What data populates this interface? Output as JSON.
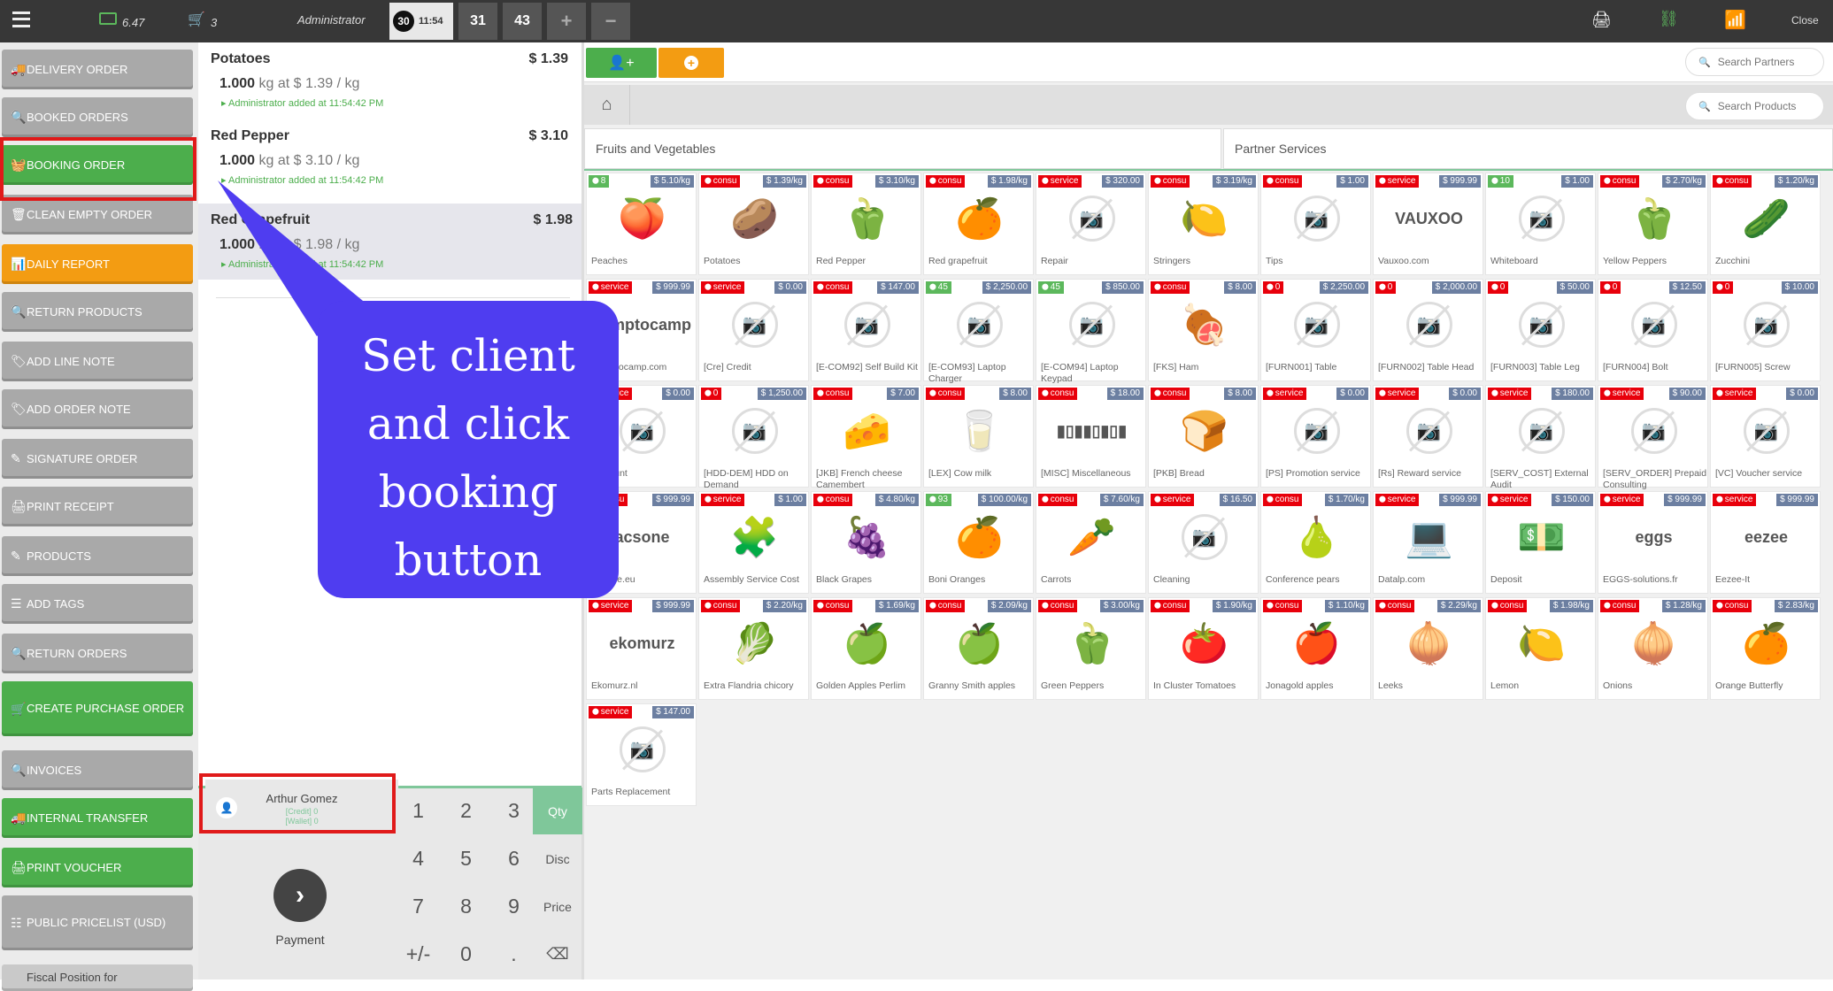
{
  "topbar": {
    "cash": "6.47",
    "cart_count": "3",
    "user": "Administrator",
    "active_order_num": "30",
    "active_order_time": "11:54",
    "tabs": [
      "31",
      "43"
    ],
    "plus": "+",
    "minus": "−",
    "close_label": "Close"
  },
  "left_controls": [
    {
      "label": "DELIVERY ORDER",
      "icon": "truck-icon",
      "glyph": "🚚"
    },
    {
      "label": "BOOKED ORDERS",
      "icon": "search-icon",
      "glyph": "🔍"
    },
    {
      "label": "BOOKING ORDER",
      "icon": "basket-icon",
      "glyph": "🧺"
    },
    {
      "label": "CLEAN EMPTY ORDER",
      "icon": "trash-icon",
      "glyph": "🗑"
    },
    {
      "label": "DAILY REPORT",
      "icon": "bar-chart-icon",
      "glyph": "📊"
    },
    {
      "label": "RETURN PRODUCTS",
      "icon": "search-icon",
      "glyph": "🔍"
    },
    {
      "label": "ADD LINE NOTE",
      "icon": "tag-icon",
      "glyph": "🏷"
    },
    {
      "label": "ADD ORDER NOTE",
      "icon": "tag-icon",
      "glyph": "🏷"
    },
    {
      "label": "SIGNATURE ORDER",
      "icon": "edit-icon",
      "glyph": "✎"
    },
    {
      "label": "PRINT RECEIPT",
      "icon": "print-icon",
      "glyph": "🖨"
    },
    {
      "label": "PRODUCTS",
      "icon": "edit-icon",
      "glyph": "✎"
    },
    {
      "label": "ADD TAGS",
      "icon": "sliders-icon",
      "glyph": "☰"
    },
    {
      "label": "RETURN ORDERS",
      "icon": "search-icon",
      "glyph": "🔍"
    },
    {
      "label": "CREATE PURCHASE ORDER",
      "icon": "cart-icon",
      "glyph": "🛒"
    },
    {
      "label": "INVOICES",
      "icon": "search-icon",
      "glyph": "🔍"
    },
    {
      "label": "INTERNAL TRANSFER",
      "icon": "truck-icon",
      "glyph": "🚚"
    },
    {
      "label": "PRINT VOUCHER",
      "icon": "print-icon",
      "glyph": "🖨"
    },
    {
      "label": "PUBLIC PRICELIST (USD)",
      "icon": "list-icon",
      "glyph": "☷"
    },
    {
      "label": "Fiscal Position for",
      "icon": "",
      "glyph": ""
    }
  ],
  "order_lines": [
    {
      "name": "Potatoes",
      "price": "$ 1.39",
      "qty": "1.000",
      "qty_text": "kg at $ 1.39 / kg",
      "note": "Administrator added at 11:54:42 PM"
    },
    {
      "name": "Red Pepper",
      "price": "$ 3.10",
      "qty": "1.000",
      "qty_text": "kg at $ 3.10 / kg",
      "note": "Administrator added at 11:54:42 PM"
    },
    {
      "name": "Red Grapefruit",
      "price": "$ 1.98",
      "qty": "1.000",
      "qty_text": "kg at $ 1.98 / kg",
      "note": "Administrator added at 11:54:42 PM"
    }
  ],
  "client": {
    "name": "Arthur Gomez",
    "credit": "[Credit] 0",
    "wallet": "[Wallet] 0"
  },
  "payment_label": "Payment",
  "numpad": {
    "keys": [
      "1",
      "2",
      "3",
      "4",
      "5",
      "6",
      "7",
      "8",
      "9",
      "+/-",
      "0",
      "."
    ],
    "modes": [
      "Qty",
      "Disc",
      "Price"
    ]
  },
  "callout": {
    "text": "Set client and click booking button"
  },
  "search": {
    "partners_placeholder": "Search Partners",
    "products_placeholder": "Search Products"
  },
  "categories": [
    "Fruits and Vegetables",
    "Partner Services"
  ],
  "products": [
    {
      "name": "Peaches",
      "tag": "8",
      "tag_type": "green",
      "price": "$ 5.10/kg",
      "img": "🍑"
    },
    {
      "name": "Potatoes",
      "tag": "consu",
      "tag_type": "red",
      "price": "$ 1.39/kg",
      "img": "🥔"
    },
    {
      "name": "Red Pepper",
      "tag": "consu",
      "tag_type": "red",
      "price": "$ 3.10/kg",
      "img": "🫑"
    },
    {
      "name": "Red grapefruit",
      "tag": "consu",
      "tag_type": "red",
      "price": "$ 1.98/kg",
      "img": "🍊"
    },
    {
      "name": "Repair",
      "tag": "service",
      "tag_type": "red",
      "price": "$ 320.00",
      "img": ""
    },
    {
      "name": "Stringers",
      "tag": "consu",
      "tag_type": "red",
      "price": "$ 3.19/kg",
      "img": "🍋"
    },
    {
      "name": "Tips",
      "tag": "consu",
      "tag_type": "red",
      "price": "$ 1.00",
      "img": ""
    },
    {
      "name": "Vauxoo.com",
      "tag": "service",
      "tag_type": "red",
      "price": "$ 999.99",
      "img": "VAUXOO"
    },
    {
      "name": "Whiteboard",
      "tag": "10",
      "tag_type": "green",
      "price": "$ 1.00",
      "img": ""
    },
    {
      "name": "Yellow Peppers",
      "tag": "consu",
      "tag_type": "red",
      "price": "$ 2.70/kg",
      "img": "🫑"
    },
    {
      "name": "Zucchini",
      "tag": "consu",
      "tag_type": "red",
      "price": "$ 1.20/kg",
      "img": "🥒"
    },
    {
      "name": "Camptocamp.com",
      "tag": "service",
      "tag_type": "red",
      "price": "$ 999.99",
      "img": "camptocamp"
    },
    {
      "name": "[Cre] Credit",
      "tag": "service",
      "tag_type": "red",
      "price": "$ 0.00",
      "img": ""
    },
    {
      "name": "[E-COM92] Self Build Kit",
      "tag": "consu",
      "tag_type": "red",
      "price": "$ 147.00",
      "img": ""
    },
    {
      "name": "[E-COM93] Laptop Charger",
      "tag": "45",
      "tag_type": "green",
      "price": "$ 2,250.00",
      "img": ""
    },
    {
      "name": "[E-COM94] Laptop Keypad",
      "tag": "45",
      "tag_type": "green",
      "price": "$ 850.00",
      "img": ""
    },
    {
      "name": "[FKS] Ham",
      "tag": "consu",
      "tag_type": "red",
      "price": "$ 8.00",
      "img": "🍖"
    },
    {
      "name": "[FURN001] Table",
      "tag": "0",
      "tag_type": "red",
      "price": "$ 2,250.00",
      "img": ""
    },
    {
      "name": "[FURN002] Table Head",
      "tag": "0",
      "tag_type": "red",
      "price": "$ 2,000.00",
      "img": ""
    },
    {
      "name": "[FURN003] Table Leg",
      "tag": "0",
      "tag_type": "red",
      "price": "$ 50.00",
      "img": ""
    },
    {
      "name": "[FURN004] Bolt",
      "tag": "0",
      "tag_type": "red",
      "price": "$ 12.50",
      "img": ""
    },
    {
      "name": "[FURN005] Screw",
      "tag": "0",
      "tag_type": "red",
      "price": "$ 10.00",
      "img": ""
    },
    {
      "name": "Discount",
      "tag": "service",
      "tag_type": "red",
      "price": "$ 0.00",
      "img": ""
    },
    {
      "name": "[HDD-DEM] HDD on Demand",
      "tag": "0",
      "tag_type": "red",
      "price": "$ 1,250.00",
      "img": ""
    },
    {
      "name": "[JKB] French cheese Camembert",
      "tag": "consu",
      "tag_type": "red",
      "price": "$ 7.00",
      "img": "🧀"
    },
    {
      "name": "[LEX] Cow milk",
      "tag": "consu",
      "tag_type": "red",
      "price": "$ 8.00",
      "img": "🥛"
    },
    {
      "name": "[MISC] Miscellaneous",
      "tag": "consu",
      "tag_type": "red",
      "price": "$ 18.00",
      "img": "▮▯▮▮▯▮▯▮"
    },
    {
      "name": "[PKB] Bread",
      "tag": "consu",
      "tag_type": "red",
      "price": "$ 8.00",
      "img": "🍞"
    },
    {
      "name": "[PS] Promotion service",
      "tag": "service",
      "tag_type": "red",
      "price": "$ 0.00",
      "img": ""
    },
    {
      "name": "[Rs] Reward service",
      "tag": "service",
      "tag_type": "red",
      "price": "$ 0.00",
      "img": ""
    },
    {
      "name": "[SERV_COST] External Audit",
      "tag": "service",
      "tag_type": "red",
      "price": "$ 180.00",
      "img": ""
    },
    {
      "name": "[SERV_ORDER] Prepaid Consulting",
      "tag": "service",
      "tag_type": "red",
      "price": "$ 90.00",
      "img": ""
    },
    {
      "name": "[VC] Voucher service",
      "tag": "service",
      "tag_type": "red",
      "price": "$ 0.00",
      "img": ""
    },
    {
      "name": "Acsone.eu",
      "tag": "consu",
      "tag_type": "red",
      "price": "$ 999.99",
      "img": "acsone"
    },
    {
      "name": "Assembly Service Cost",
      "tag": "service",
      "tag_type": "red",
      "price": "$ 1.00",
      "img": "🧩"
    },
    {
      "name": "Black Grapes",
      "tag": "consu",
      "tag_type": "red",
      "price": "$ 4.80/kg",
      "img": "🍇"
    },
    {
      "name": "Boni Oranges",
      "tag": "93",
      "tag_type": "green",
      "price": "$ 100.00/kg",
      "img": "🍊"
    },
    {
      "name": "Carrots",
      "tag": "consu",
      "tag_type": "red",
      "price": "$ 7.60/kg",
      "img": "🥕"
    },
    {
      "name": "Cleaning",
      "tag": "service",
      "tag_type": "red",
      "price": "$ 16.50",
      "img": ""
    },
    {
      "name": "Conference pears",
      "tag": "consu",
      "tag_type": "red",
      "price": "$ 1.70/kg",
      "img": "🍐"
    },
    {
      "name": "Datalp.com",
      "tag": "service",
      "tag_type": "red",
      "price": "$ 999.99",
      "img": "💻"
    },
    {
      "name": "Deposit",
      "tag": "service",
      "tag_type": "red",
      "price": "$ 150.00",
      "img": "💵"
    },
    {
      "name": "EGGS-solutions.fr",
      "tag": "service",
      "tag_type": "red",
      "price": "$ 999.99",
      "img": "eggs"
    },
    {
      "name": "Eezee-It",
      "tag": "service",
      "tag_type": "red",
      "price": "$ 999.99",
      "img": "eezee"
    },
    {
      "name": "Ekomurz.nl",
      "tag": "service",
      "tag_type": "red",
      "price": "$ 999.99",
      "img": "ekomurz"
    },
    {
      "name": "Extra Flandria chicory",
      "tag": "consu",
      "tag_type": "red",
      "price": "$ 2.20/kg",
      "img": "🥬"
    },
    {
      "name": "Golden Apples Perlim",
      "tag": "consu",
      "tag_type": "red",
      "price": "$ 1.69/kg",
      "img": "🍏"
    },
    {
      "name": "Granny Smith apples",
      "tag": "consu",
      "tag_type": "red",
      "price": "$ 2.09/kg",
      "img": "🍏"
    },
    {
      "name": "Green Peppers",
      "tag": "consu",
      "tag_type": "red",
      "price": "$ 3.00/kg",
      "img": "🫑"
    },
    {
      "name": "In Cluster Tomatoes",
      "tag": "consu",
      "tag_type": "red",
      "price": "$ 1.90/kg",
      "img": "🍅"
    },
    {
      "name": "Jonagold apples",
      "tag": "consu",
      "tag_type": "red",
      "price": "$ 1.10/kg",
      "img": "🍎"
    },
    {
      "name": "Leeks",
      "tag": "consu",
      "tag_type": "red",
      "price": "$ 2.29/kg",
      "img": "🧅"
    },
    {
      "name": "Lemon",
      "tag": "consu",
      "tag_type": "red",
      "price": "$ 1.98/kg",
      "img": "🍋"
    },
    {
      "name": "Onions",
      "tag": "consu",
      "tag_type": "red",
      "price": "$ 1.28/kg",
      "img": "🧅"
    },
    {
      "name": "Orange Butterfly",
      "tag": "consu",
      "tag_type": "red",
      "price": "$ 2.83/kg",
      "img": "🍊"
    },
    {
      "name": "Parts Replacement",
      "tag": "service",
      "tag_type": "red",
      "price": "$ 147.00",
      "img": ""
    }
  ],
  "colors": {
    "green": "#4cae4c",
    "orange": "#f39c12",
    "gray": "#a9a9a9",
    "callout": "#4f3df0",
    "highlight": "#e01a1a"
  }
}
